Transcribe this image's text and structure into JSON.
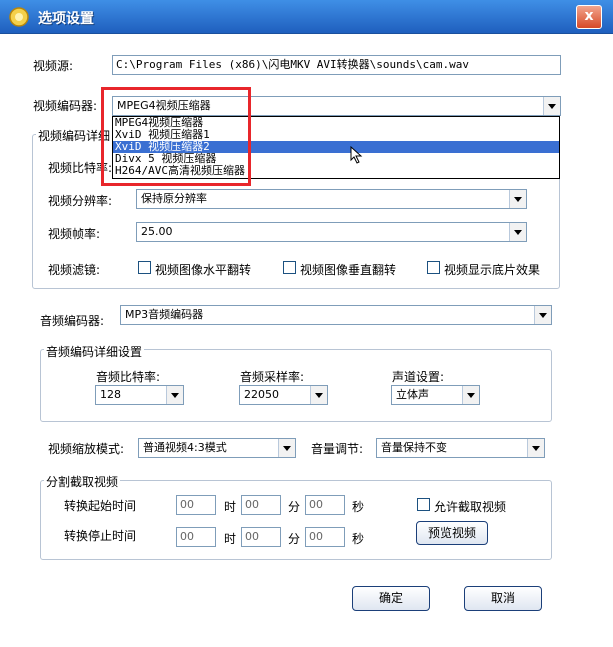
{
  "window": {
    "title": "选项设置",
    "close_label": "x"
  },
  "video_source": {
    "label": "视频源:",
    "value": "C:\\Program Files (x86)\\闪电MKV AVI转换器\\sounds\\cam.wav"
  },
  "video_encoder": {
    "label": "视频编码器:",
    "selected": "MPEG4视频压缩器",
    "options": [
      "MPEG4视频压缩器",
      "XviD 视频压缩器1",
      "XviD 视频压缩器2",
      "Divx 5 视频压缩器",
      "H264/AVC高清视频压缩器"
    ],
    "hovered_index": 2
  },
  "video_detail": {
    "group_title": "视频编码详细",
    "bitrate_label": "视频比特率:",
    "resolution_label": "视频分辨率:",
    "resolution_value": "保持原分辨率",
    "framerate_label": "视频帧率:",
    "framerate_value": "25.00",
    "filter_label": "视频滤镜:",
    "filters": [
      "视频图像水平翻转",
      "视频图像垂直翻转",
      "视频显示底片效果"
    ]
  },
  "audio_encoder": {
    "label": "音频编码器:",
    "value": "MP3音频编码器"
  },
  "audio_detail": {
    "group_title": "音频编码详细设置",
    "bitrate_label": "音频比特率:",
    "bitrate_value": "128",
    "samplerate_label": "音频采样率:",
    "samplerate_value": "22050",
    "channel_label": "声道设置:",
    "channel_value": "立体声"
  },
  "scale": {
    "label": "视频缩放模式:",
    "value": "普通视频4:3模式"
  },
  "volume": {
    "label": "音量调节:",
    "value": "音量保持不变"
  },
  "split": {
    "group_title": "分割截取视频",
    "start_label": "转换起始时间",
    "stop_label": "转换停止时间",
    "hour": "时",
    "minute": "分",
    "second": "秒",
    "placeholder": "00",
    "allow_label": "允许截取视频",
    "preview_label": "预览视频"
  },
  "buttons": {
    "ok": "确定",
    "cancel": "取消"
  }
}
